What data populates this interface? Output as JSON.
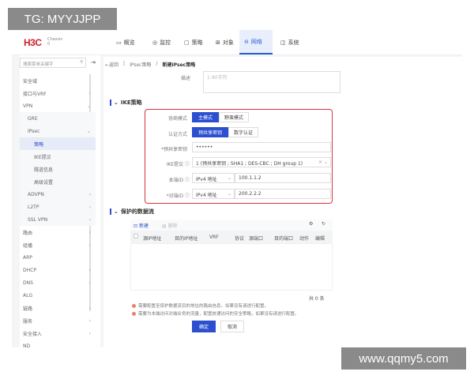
{
  "watermarks": {
    "top_left": "TG: MYYJJPP",
    "bottom_right": "www.qqmy5.com"
  },
  "header": {
    "logo": "H3C",
    "logo_sub": "Chassis",
    "logo_sub2": "0",
    "nav": [
      {
        "label": "概览",
        "icon": "monitor-icon"
      },
      {
        "label": "监控",
        "icon": "eye-icon"
      },
      {
        "label": "策略",
        "icon": "clipboard-icon"
      },
      {
        "label": "对象",
        "icon": "grid-icon"
      },
      {
        "label": "网络",
        "icon": "lock-icon",
        "active": true
      },
      {
        "label": "系统",
        "icon": "window-icon"
      }
    ]
  },
  "sidebar": {
    "search_placeholder": "搜索菜单关键字",
    "items": [
      {
        "label": "安全域"
      },
      {
        "label": "接口与VRF",
        "chevron": "›"
      },
      {
        "label": "VPN",
        "chevron": "⌄"
      },
      {
        "label": "GRE"
      },
      {
        "label": "IPsec",
        "chevron": "⌄"
      },
      {
        "label": "策略",
        "active": true
      },
      {
        "label": "IKE提议"
      },
      {
        "label": "隧道信息"
      },
      {
        "label": "高级设置"
      },
      {
        "label": "ADVPN",
        "chevron": "›"
      },
      {
        "label": "L2TP",
        "chevron": "›"
      },
      {
        "label": "SSL VPN",
        "chevron": "›"
      },
      {
        "label": "路由",
        "chevron": "›"
      },
      {
        "label": "组播",
        "chevron": "›"
      },
      {
        "label": "ARP"
      },
      {
        "label": "DHCP",
        "chevron": "›"
      },
      {
        "label": "DNS",
        "chevron": "›"
      },
      {
        "label": "ALG"
      },
      {
        "label": "链路",
        "chevron": "›"
      },
      {
        "label": "服务",
        "chevron": "›"
      },
      {
        "label": "安全接入",
        "chevron": "›"
      },
      {
        "label": "ND"
      }
    ]
  },
  "breadcrumb": {
    "back": "←返回",
    "sep": "|",
    "parent": "IPsec策略",
    "slash": "/",
    "current": "新建IPsec策略"
  },
  "description": {
    "label": "描述",
    "placeholder": "1-80字符"
  },
  "ike": {
    "title": "IKE策略",
    "negotiation": {
      "label": "协商模式",
      "options": [
        "主模式",
        "野蛮模式"
      ],
      "selected": "主模式"
    },
    "auth": {
      "label": "认证方式",
      "options": [
        "预共享密钥",
        "数字认证"
      ],
      "selected": "预共享密钥"
    },
    "psk": {
      "label": "*预共享密钥",
      "value": "••••••"
    },
    "proposal": {
      "label": "IKE提议",
      "value": "1 (预共享密钥 ; SHA1 ; DES-CBC ; DH group 1)"
    },
    "local_id": {
      "label": "本端ID",
      "type": "IPv4 地址",
      "value": "100.1.1.2"
    },
    "remote_id": {
      "label": "*对端ID",
      "type": "IPv4 地址",
      "value": "200.2.2.2"
    },
    "highlight_color": "#d9333f"
  },
  "flow": {
    "title": "保护的数据流",
    "new": "新建",
    "delete": "删除",
    "columns": [
      "源IP地址",
      "目的IP地址",
      "VRF",
      "协议",
      "源端口",
      "目的端口",
      "动作",
      "编辑"
    ],
    "total": "共 0 条",
    "notes": [
      "需要配置至保护数据流目的地址的路由信息，如果没有请进行配置。",
      "需要为本端访问对端业务的流量，配置放通访问的安全策略，如果没有请进行配置。"
    ]
  },
  "actions": {
    "ok": "确定",
    "cancel": "取消"
  },
  "colors": {
    "accent": "#2b4fcf",
    "logo": "#d0202a"
  }
}
